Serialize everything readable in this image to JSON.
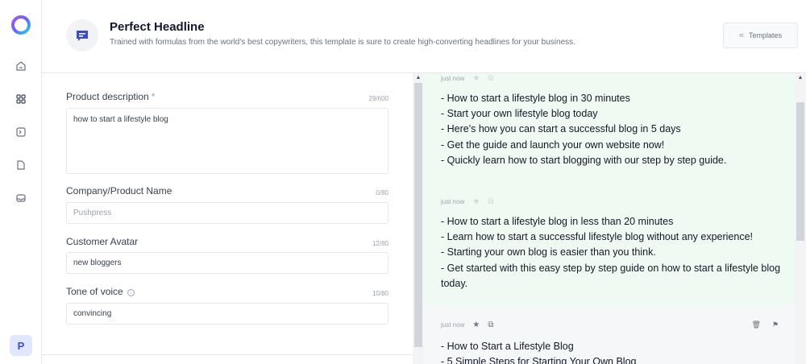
{
  "header": {
    "title": "Perfect Headline",
    "subtitle": "Trained with formulas from the world's best copywriters, this template is sure to create high-converting headlines for your business.",
    "templates_label": "Templates"
  },
  "sidebar": {
    "avatar_initial": "P",
    "icons": [
      "home-icon",
      "grid-icon",
      "terminal-icon",
      "document-icon",
      "inbox-icon"
    ]
  },
  "form": {
    "product_description": {
      "label": "Product description",
      "required_mark": "*",
      "counter": "29/600",
      "value": "how to start a lifestyle blog"
    },
    "company_name": {
      "label": "Company/Product Name",
      "counter": "0/80",
      "placeholder": "Pushpress"
    },
    "customer_avatar": {
      "label": "Customer Avatar",
      "counter": "12/80",
      "value": "new bloggers"
    },
    "tone_of_voice": {
      "label": "Tone of voice",
      "info": "i",
      "counter": "10/80",
      "value": "convincing"
    }
  },
  "results": [
    {
      "time": "just now",
      "lines": [
        "- How to start a lifestyle blog in 30 minutes",
        "- Start your own lifestyle blog today",
        "- Here's how you can start a successful blog in 5 days",
        "- Get the guide and launch your own website now!",
        "- Quickly learn how to start blogging with our step by step guide."
      ]
    },
    {
      "time": "just now",
      "lines": [
        "- How to start a lifestyle blog in less than 20 minutes",
        "- Learn how to start a successful lifestyle blog without any experience!",
        "- Starting your own blog is easier than you think.",
        "- Get started with this easy step by step guide on how to start a lifestyle blog today."
      ]
    },
    {
      "time": "just now",
      "lines": [
        "- How to Start a Lifestyle Blog",
        "- 5 Simple Steps for Starting Your Own Blog"
      ]
    }
  ],
  "colors": {
    "accent": "#3b4cca",
    "result_highlight": "#effbf2"
  }
}
